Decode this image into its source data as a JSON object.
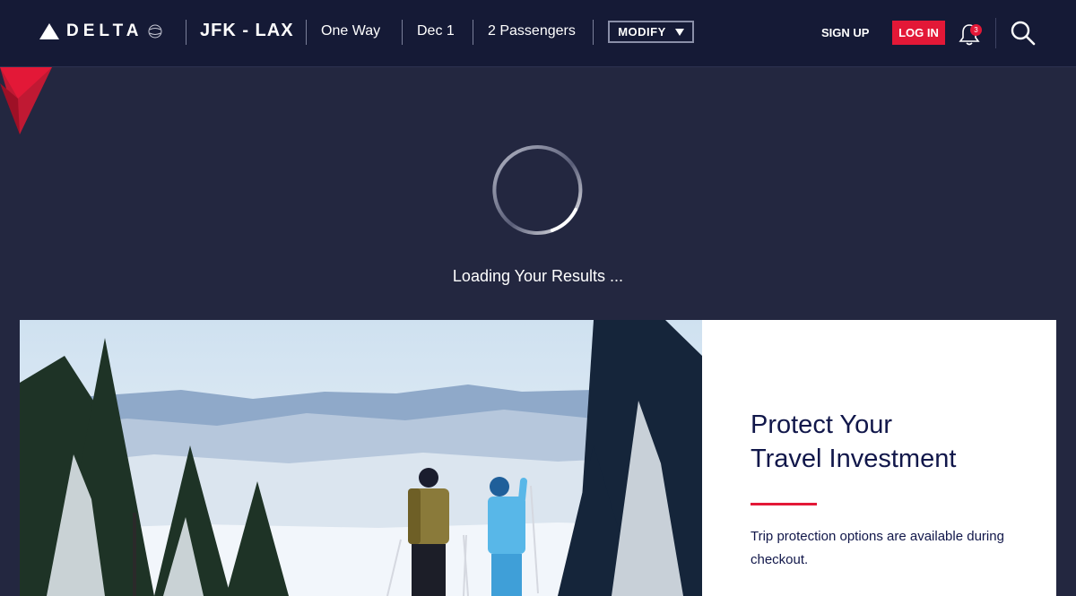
{
  "brand": {
    "name": "DELTA"
  },
  "header": {
    "route": "JFK - LAX",
    "trip_type": "One Way",
    "date": "Dec 1",
    "passengers": "2 Passengers",
    "modify_label": "MODIFY",
    "signup_label": "SIGN UP",
    "login_label": "LOG IN",
    "notification_count": "3"
  },
  "loading": {
    "text": "Loading Your Results ..."
  },
  "promo": {
    "title_line1": "Protect Your",
    "title_line2": "Travel Investment",
    "body": "Trip protection options are available during checkout."
  },
  "colors": {
    "navy": "#151a36",
    "background": "#232740",
    "accent_red": "#e31837",
    "text_navy": "#11174a"
  }
}
